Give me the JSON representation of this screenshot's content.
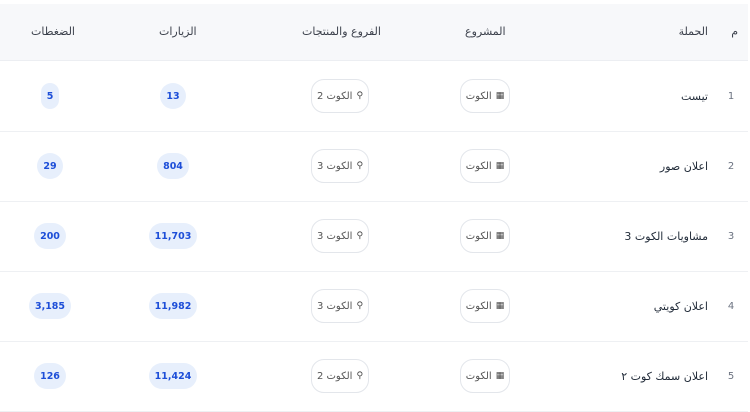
{
  "headers": {
    "num": "م",
    "campaign": "الحملة",
    "project": "المشروع",
    "branches": "الفروع والمنتجات",
    "visits": "الزيارات",
    "clicks": "الضغطات"
  },
  "icons": {
    "project": "building-icon",
    "branch": "pin-icon"
  },
  "colors": {
    "badge_bg": "#e7effc",
    "badge_text": "#1d4ed8"
  },
  "rows": [
    {
      "num": "1",
      "campaign": "تيست",
      "project": "الكوت",
      "branch": "الكوت 2",
      "visits": "13",
      "clicks": "5"
    },
    {
      "num": "2",
      "campaign": "اعلان صور",
      "project": "الكوت",
      "branch": "الكوت 3",
      "visits": "804",
      "clicks": "29"
    },
    {
      "num": "3",
      "campaign": "مشاويات الكوت 3",
      "project": "الكوت",
      "branch": "الكوت 3",
      "visits": "11,703",
      "clicks": "200"
    },
    {
      "num": "4",
      "campaign": "اعلان كويتي",
      "project": "الكوت",
      "branch": "الكوت 3",
      "visits": "11,982",
      "clicks": "3,185"
    },
    {
      "num": "5",
      "campaign": "اعلان سمك كوت ٢",
      "project": "الكوت",
      "branch": "الكوت 2",
      "visits": "11,424",
      "clicks": "126"
    }
  ]
}
